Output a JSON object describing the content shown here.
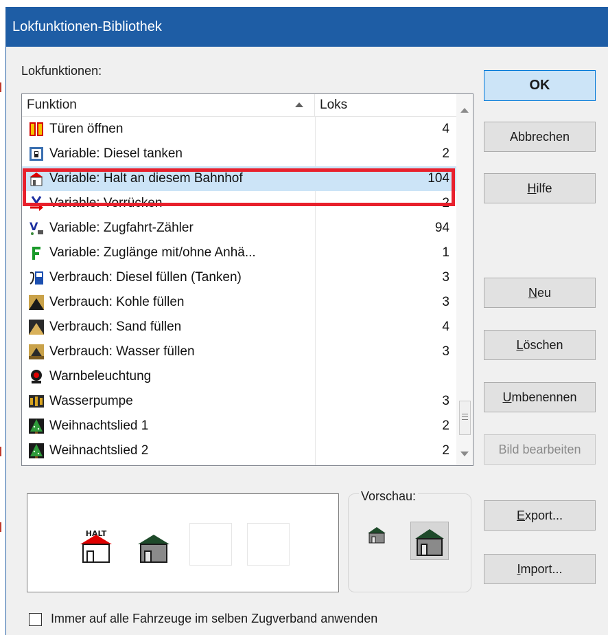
{
  "window": {
    "title": "Lokfunktionen-Bibliothek"
  },
  "list": {
    "section_label": "Lokfunktionen:",
    "columns": {
      "funktion": "Funktion",
      "loks": "Loks"
    },
    "rows": [
      {
        "name": "Türen öffnen",
        "loks": "4",
        "icon": "doors-icon"
      },
      {
        "name": "Variable: Diesel tanken",
        "loks": "2",
        "icon": "fuel-pump-icon"
      },
      {
        "name": "Variable: Halt an diesem Bahnhof",
        "loks": "104",
        "icon": "halt-station-icon"
      },
      {
        "name": "Variable: Vorrücken",
        "loks": "2",
        "icon": "advance-arrow-icon"
      },
      {
        "name": "Variable: Zugfahrt-Zähler",
        "loks": "94",
        "icon": "trip-counter-icon"
      },
      {
        "name": "Variable: Zuglänge mit/ohne Anhä...",
        "loks": "1",
        "icon": "train-length-icon"
      },
      {
        "name": "Verbrauch: Diesel füllen (Tanken)",
        "loks": "3",
        "icon": "diesel-refuel-icon"
      },
      {
        "name": "Verbrauch: Kohle füllen",
        "loks": "3",
        "icon": "coal-pile-icon"
      },
      {
        "name": "Verbrauch: Sand füllen",
        "loks": "4",
        "icon": "sand-pile-icon"
      },
      {
        "name": "Verbrauch: Wasser füllen",
        "loks": "3",
        "icon": "water-pile-icon"
      },
      {
        "name": "Warnbeleuchtung",
        "loks": "",
        "icon": "warning-light-icon"
      },
      {
        "name": "Wasserpumpe",
        "loks": "3",
        "icon": "water-pump-icon"
      },
      {
        "name": "Weihnachtslied 1",
        "loks": "2",
        "icon": "christmas-tree-icon"
      },
      {
        "name": "Weihnachtslied 2",
        "loks": "2",
        "icon": "christmas-tree-icon"
      }
    ],
    "selected_index": 2
  },
  "buttons": {
    "ok": "OK",
    "abbrechen": "Abbrechen",
    "hilfe_pre": "",
    "hilfe_u": "H",
    "hilfe_post": "ilfe",
    "neu_u": "N",
    "neu_post": "eu",
    "loeschen_u": "L",
    "loeschen_post": "öschen",
    "umbenennen_u": "U",
    "umbenennen_post": "mbenennen",
    "bild_bearbeiten": "Bild bearbeiten",
    "export_u": "E",
    "export_post": "xport...",
    "import_u": "I",
    "import_post": "mport..."
  },
  "preview": {
    "label": "Vorschau:",
    "halt_sign": "HALT"
  },
  "checkbox": {
    "label": "Immer auf alle Fahrzeuge im selben Zugverband anwenden",
    "checked": false
  },
  "colors": {
    "titlebar": "#1e5da5",
    "selection": "#cce4f7",
    "highlight_frame": "#e8202c",
    "ok_border": "#0078d7"
  }
}
